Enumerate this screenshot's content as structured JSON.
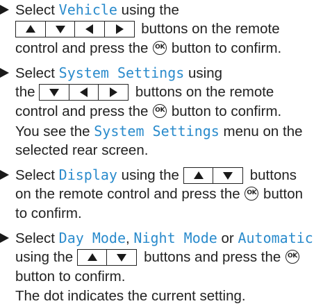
{
  "steps": [
    {
      "lines": [
        [
          "Select ",
          {
            "hl": "Vehicle"
          },
          " using the"
        ],
        [
          {
            "keys": [
              "up",
              "down",
              "left",
              "right"
            ]
          },
          " buttons on the remote"
        ],
        [
          "control and press the ",
          {
            "ok": "OK"
          },
          " button to confirm."
        ]
      ]
    },
    {
      "lines": [
        [
          "Select ",
          {
            "hl": "System Settings"
          },
          " using"
        ],
        [
          "the ",
          {
            "keys": [
              "down",
              "left",
              "right"
            ]
          },
          " buttons on the remote"
        ],
        [
          "control and press the ",
          {
            "ok": "OK"
          },
          " button to confirm."
        ],
        [
          "You see the ",
          {
            "hl": "System Settings"
          },
          " menu on the"
        ],
        [
          "selected rear screen."
        ]
      ]
    },
    {
      "lines": [
        [
          "Select ",
          {
            "hl": "Display"
          },
          " using the ",
          {
            "keys": [
              "up",
              "down"
            ]
          },
          " buttons"
        ],
        [
          "on the remote control and press the ",
          {
            "ok": "OK"
          },
          " button"
        ],
        [
          "to confirm."
        ]
      ]
    },
    {
      "lines": [
        [
          "Select ",
          {
            "hl": "Day Mode"
          },
          ", ",
          {
            "hl": "Night Mode"
          },
          " or ",
          {
            "hl": "Automatic"
          }
        ],
        [
          "using the ",
          {
            "keys": [
              "up",
              "down"
            ]
          },
          " buttons and press the ",
          {
            "ok": "OK"
          }
        ],
        [
          "button to confirm."
        ],
        [
          "The dot indicates the current setting."
        ]
      ]
    }
  ],
  "icons": {
    "bullet": "triangle-bullet-icon",
    "ok": "ok-button-icon",
    "up": "arrow-up-icon",
    "down": "arrow-down-icon",
    "left": "arrow-left-icon",
    "right": "arrow-right-icon"
  }
}
